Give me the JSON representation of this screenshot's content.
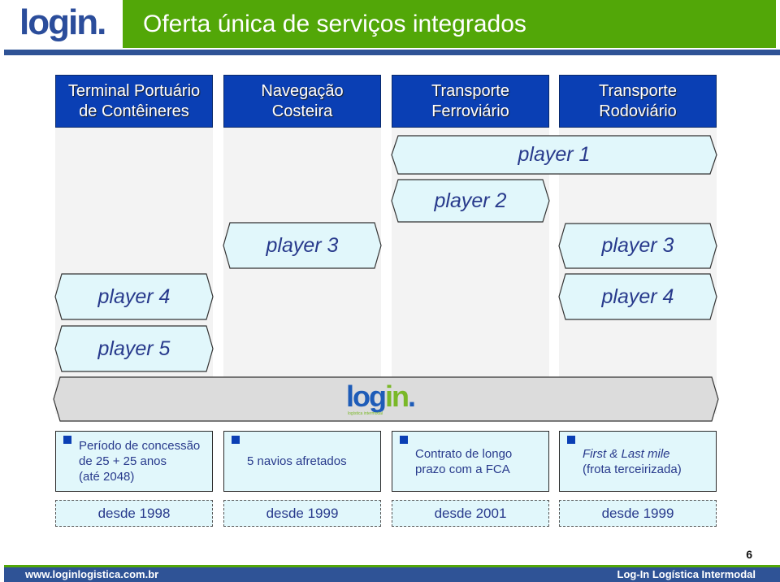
{
  "header": {
    "logo": {
      "part1": "log",
      "part2": "in",
      "dot": "."
    },
    "title": "Oferta única de serviços integrados"
  },
  "columns": [
    {
      "label": "Terminal Portuário\nde Contêineres",
      "description": "Período de concessão\nde 25 + 25 anos\n(até 2048)",
      "description_italic": false,
      "since": "desde 1998"
    },
    {
      "label": "Navegação\nCosteira",
      "description": "5 navios afretados",
      "description_italic": false,
      "since": "desde 1999"
    },
    {
      "label": "Transporte\nFerroviário",
      "description": "Contrato de longo\nprazo com a FCA",
      "description_italic": false,
      "since": "desde 2001"
    },
    {
      "label": "Transporte\nRodoviário",
      "description_italic_part": "First & Last mile",
      "description": "(frota terceirizada)",
      "since": "desde 1999"
    }
  ],
  "players": [
    {
      "label": "player 1",
      "spans": "Transporte Ferroviário – Transporte Rodoviário"
    },
    {
      "label": "player 2",
      "spans": "Transporte Ferroviário"
    },
    {
      "label": "player 3",
      "spans": "Navegação Costeira"
    },
    {
      "label": "player 3",
      "spans": "Transporte Rodoviário"
    },
    {
      "label": "player 4",
      "spans": "Terminal Portuário de Contêineres"
    },
    {
      "label": "player 4",
      "spans": "Transporte Rodoviário"
    },
    {
      "label": "player 5",
      "spans": "Terminal Portuário de Contêineres"
    }
  ],
  "integrated_bar": {
    "logo": {
      "part1": "log",
      "part2": "in",
      "dot": ".",
      "tagline": "logística intermodal"
    }
  },
  "footer": {
    "page_number": "6",
    "url": "www.loginlogistica.com.br",
    "company": "Log-In Logística Intermodal"
  },
  "colors": {
    "title_green": "#52a708",
    "rule_blue": "#2f5396",
    "column_header_blue": "#0a3fb4",
    "player_fill": "#e1f7fb",
    "player_text": "#283a8c",
    "integrated_bar_fill": "#dcdcdc"
  }
}
